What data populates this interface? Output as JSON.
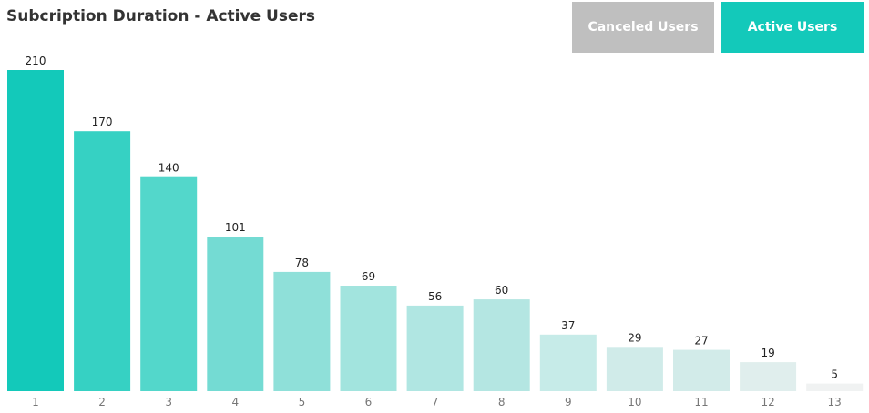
{
  "header": {
    "title": "Subcription Duration - Active Users"
  },
  "toggle": {
    "canceled_label": "Canceled Users",
    "active_label": "Active Users",
    "selected": "Active Users",
    "canceled_color": "#bfbfbf",
    "active_color": "#13c9ba"
  },
  "chart_data": {
    "type": "bar",
    "title": "Subcription Duration - Active Users",
    "xlabel": "",
    "ylabel": "",
    "categories": [
      "1",
      "2",
      "3",
      "4",
      "5",
      "6",
      "7",
      "8",
      "9",
      "10",
      "11",
      "12",
      "13"
    ],
    "values": [
      210,
      170,
      140,
      101,
      78,
      69,
      56,
      60,
      37,
      29,
      27,
      19,
      5
    ],
    "ylim": [
      0,
      210
    ],
    "grid": false,
    "data_labels": true,
    "bar_colors": [
      "#13c9ba",
      "#36d1c3",
      "#53d7cb",
      "#74dbd3",
      "#8fe0d9",
      "#a2e4de",
      "#b0e6e2",
      "#b4e6e2",
      "#c6ebe8",
      "#d0ebe9",
      "#d2ebe9",
      "#e0eeed",
      "#f0f2f2"
    ]
  }
}
